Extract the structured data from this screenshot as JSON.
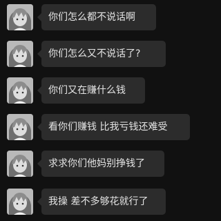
{
  "messages": [
    {
      "text": "你们怎么都不说话啊",
      "width": 166
    },
    {
      "text": "你们怎么又不说话了?",
      "width": 180
    },
    {
      "text": "你们又在赚什么钱",
      "width": 150
    },
    {
      "text": "看你们赚钱 比我亏钱还难受",
      "width": 215
    },
    {
      "text": "求求你们他妈别挣钱了",
      "width": 178
    },
    {
      "text": "我操 差不多够花就行了",
      "width": 180
    }
  ],
  "avatar_icon": "anime-character-avatar"
}
